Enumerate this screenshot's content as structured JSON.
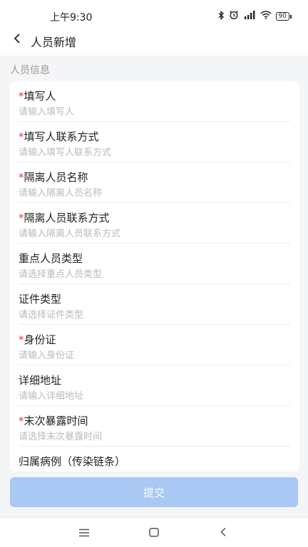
{
  "status_bar": {
    "time": "上午9:30",
    "battery": "90"
  },
  "header": {
    "title": "人员新增"
  },
  "section": {
    "title": "人员信息"
  },
  "fields": [
    {
      "label": "填写人",
      "required": true,
      "placeholder": "请输入填写人"
    },
    {
      "label": "填写人联系方式",
      "required": true,
      "placeholder": "请输入填写人联系方式"
    },
    {
      "label": "隔离人员名称",
      "required": true,
      "placeholder": "请输入隔离人员名称"
    },
    {
      "label": "隔离人员联系方式",
      "required": true,
      "placeholder": "请输入隔离人员联系方式"
    },
    {
      "label": "重点人员类型",
      "required": false,
      "placeholder": "请选择重点人员类型"
    },
    {
      "label": "证件类型",
      "required": false,
      "placeholder": "请选择证件类型"
    },
    {
      "label": "身份证",
      "required": true,
      "placeholder": "请输入身份证"
    },
    {
      "label": "详细地址",
      "required": false,
      "placeholder": "请输入详细地址"
    },
    {
      "label": "末次暴露时间",
      "required": true,
      "placeholder": "请选择末次暴露时间"
    },
    {
      "label": "归属病例（传染链条）",
      "required": false,
      "placeholder": ""
    }
  ],
  "required_mark": "*",
  "submit": {
    "label": "提交"
  },
  "colors": {
    "accent_disabled": "#a9c8f4",
    "required": "#e53935",
    "placeholder": "#bbbbbb"
  }
}
